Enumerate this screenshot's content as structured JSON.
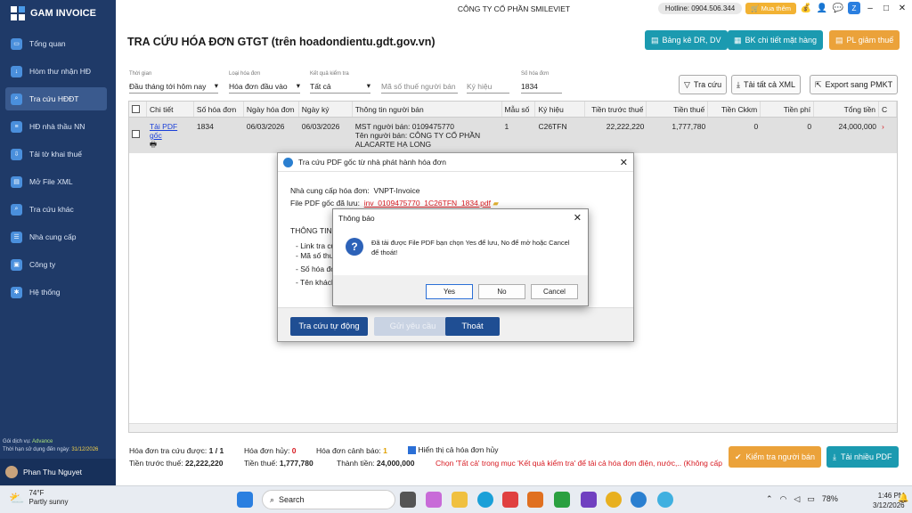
{
  "app": {
    "name": "GAM INVOICE",
    "company": "CÔNG TY CỔ PHẦN SMILEVIET",
    "hotline": "Hotline: 0904.506.344",
    "buy": "Mua thêm"
  },
  "sidebar": {
    "items": [
      {
        "label": "Tổng quan",
        "icon": "monitor-icon"
      },
      {
        "label": "Hòm thư nhận HĐ",
        "icon": "inbox-icon"
      },
      {
        "label": "Tra cứu HĐĐT",
        "icon": "search-icon"
      },
      {
        "label": "HĐ nhà thầu NN",
        "icon": "document-icon"
      },
      {
        "label": "Tải tờ khai thuế",
        "icon": "download-icon"
      },
      {
        "label": "Mở File XML",
        "icon": "folder-icon"
      },
      {
        "label": "Tra cứu khác",
        "icon": "search-icon"
      },
      {
        "label": "Nhà cung cấp",
        "icon": "contacts-icon"
      },
      {
        "label": "Công ty",
        "icon": "building-icon"
      },
      {
        "label": "Hệ thống",
        "icon": "settings-icon"
      }
    ],
    "license_service_label": "Gói dịch vụ:",
    "license_service": "Advance",
    "license_expiry_label": "Thời hạn sử dụng đến ngày:",
    "license_expiry": "31/12/2026",
    "user": "Phan Thu Nguyet"
  },
  "page": {
    "title": "TRA CỨU HÓA ĐƠN GTGT (trên hoadondientu.gdt.gov.vn)"
  },
  "header_buttons": {
    "bangke": "Bảng kê DR, DV",
    "bkchitiet": "BK chi tiết mặt hàng",
    "plgiamthue": "PL giảm thuế"
  },
  "filters": {
    "thoigian": {
      "label": "Thời gian",
      "value": "Đầu tháng tới hôm nay"
    },
    "loaihd": {
      "label": "Loại hóa đơn",
      "value": "Hóa đơn đầu vào"
    },
    "ketqua": {
      "label": "Kết quả kiểm tra",
      "value": "Tất cả"
    },
    "mst_placeholder": "Mã số thuế người bán",
    "kyhieu_placeholder": "Ký hiệu",
    "sohd": {
      "label": "Số hóa đơn",
      "value": "1834"
    }
  },
  "toolbar": {
    "tracuu": "Tra cứu",
    "taiall": "Tải tất cả XML",
    "export": "Export sang PMKT"
  },
  "table": {
    "columns": [
      "Chi tiết",
      "Số hóa đơn",
      "Ngày hóa đơn",
      "Ngày ký",
      "Thông tin người bán",
      "Mẫu số",
      "Ký hiệu",
      "Tiền trước thuế",
      "Tiền thuế",
      "Tiền Ckkm",
      "Tiền phí",
      "Tổng tiền",
      "C"
    ],
    "row": {
      "chitiet": "Tải PDF gốc",
      "sohd": "1834",
      "ngayhd": "06/03/2026",
      "ngayky": "06/03/2026",
      "mst": "MST người bán: 0109475770",
      "ten1": "Tên người bán: CÔNG TY CỔ PHẦN",
      "ten2": "ALACARTE HẠ LONG",
      "mauso": "1",
      "kyhieu": "C26TFN",
      "truocthue": "22,222,220",
      "thue": "1,777,780",
      "ckkm": "0",
      "phi": "0",
      "tong": "24,000,000"
    }
  },
  "summary": {
    "duoc_label": "Hóa đơn tra cứu được:",
    "duoc": "1 / 1",
    "huy_label": "Hóa đơn hủy:",
    "huy": "0",
    "canhbao_label": "Hóa đơn cảnh báo:",
    "canhbao": "1",
    "hienthi": "Hiển thị cả hóa đơn hủy",
    "truocthue_label": "Tiền trước thuế:",
    "truocthue": "22,222,220",
    "thue_label": "Tiền thuế:",
    "thue": "1,777,780",
    "thanhtien_label": "Thành tiền:",
    "thanhtien": "24,000,000",
    "hint": "Chọn 'Tất cả' trong mục 'Kết quả kiểm tra' để tải cả hóa đơn điện, nước,.. (Không cấp mã)"
  },
  "bottom_buttons": {
    "kiemtra": "Kiểm tra người bán",
    "tainhieu": "Tải nhiều PDF"
  },
  "dialog_pdf": {
    "title": "Tra cứu PDF gốc từ nhà phát hành hóa đơn",
    "ncc_label": "Nhà cung cấp hóa đơn:",
    "ncc": "VNPT-Invoice",
    "file_label": "File PDF gốc đã lưu:",
    "file": "inv_0109475770_1C26TFN_1834.pdf",
    "info_title": "THÔNG TIN",
    "lines": [
      "- Link tra cứ",
      "- Mã số thu",
      "- Số hóa đơ",
      "- Tên khách"
    ],
    "btn_tracuu": "Tra cứu tự động",
    "btn_gui": "Gửi yêu cầu",
    "btn_thoat": "Thoát"
  },
  "msgbox": {
    "title": "Thông báo",
    "text": "Đã tải được File PDF bạn chọn Yes để lưu, No để mở hoặc Cancel để thoát!",
    "yes": "Yes",
    "no": "No",
    "cancel": "Cancel"
  },
  "taskbar": {
    "temp": "74°F",
    "weather": "Partly sunny",
    "search": "Search",
    "battery": "78%",
    "time": "1:46 PM",
    "date": "3/12/2026"
  }
}
